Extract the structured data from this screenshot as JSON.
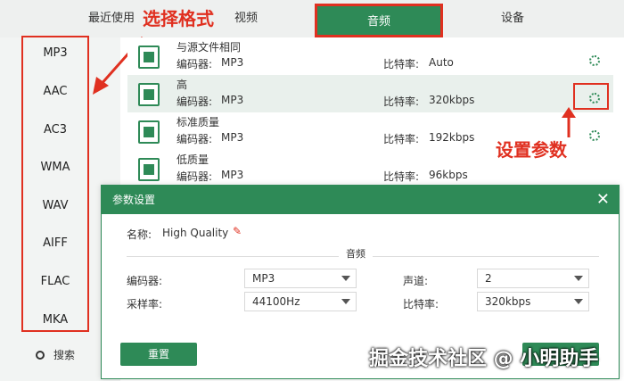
{
  "topbar": {
    "tabs": [
      {
        "label": "最近使用"
      },
      {
        "label": "视频"
      },
      {
        "label": "音频",
        "active": true
      },
      {
        "label": "设备"
      }
    ],
    "annotation": "选择格式"
  },
  "sidebar": {
    "formats": [
      "MP3",
      "AAC",
      "AC3",
      "WMA",
      "WAV",
      "AIFF",
      "FLAC",
      "MKA"
    ],
    "selected": "MP3",
    "search_label": "搜索"
  },
  "presets": [
    {
      "name": "与源文件相同",
      "encoder_label": "编码器:",
      "encoder": "MP3",
      "bitrate_label": "比特率:",
      "bitrate": "Auto"
    },
    {
      "name": "高",
      "encoder_label": "编码器:",
      "encoder": "MP3",
      "bitrate_label": "比特率:",
      "bitrate": "320kbps",
      "selected": true
    },
    {
      "name": "标准质量",
      "encoder_label": "编码器:",
      "encoder": "MP3",
      "bitrate_label": "比特率:",
      "bitrate": "192kbps"
    },
    {
      "name": "低质量",
      "encoder_label": "编码器:",
      "encoder": "MP3",
      "bitrate_label": "比特率:",
      "bitrate": "96kbps"
    }
  ],
  "annotation_params": "设置参数",
  "dialog": {
    "title": "参数设置",
    "close": "✕",
    "name_label": "名称:",
    "name_value": "High Quality",
    "section_label": "音频",
    "fields": {
      "encoder": {
        "label": "编码器:",
        "value": "MP3"
      },
      "channels": {
        "label": "声道:",
        "value": "2"
      },
      "sample_rate": {
        "label": "采样率:",
        "value": "44100Hz"
      },
      "bitrate": {
        "label": "比特率:",
        "value": "320kbps"
      }
    },
    "reset_label": "重置",
    "ok_label": ""
  },
  "watermark": "掘金技术社区 @ 小明助手",
  "colors": {
    "accent": "#2e8a57",
    "annotation": "#e03020"
  }
}
